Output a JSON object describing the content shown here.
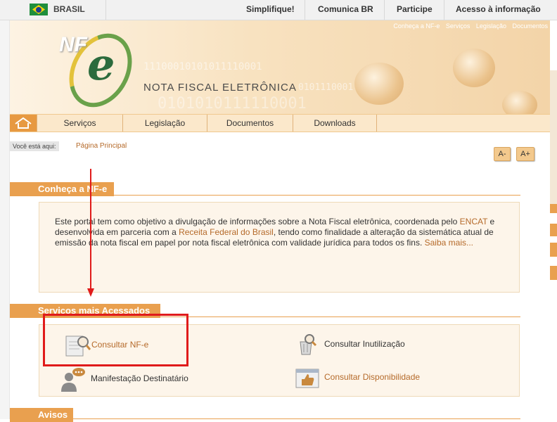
{
  "gov_bar": {
    "brand": "BRASIL",
    "links": [
      "Simplifique!",
      "Comunica BR",
      "Participe",
      "Acesso à informação"
    ]
  },
  "banner": {
    "top_links": [
      "Conheça a NF-e",
      "Serviços",
      "Legislação",
      "Documentos"
    ],
    "logo_text": "NF",
    "logo_letter": "e",
    "title": "NOTA FISCAL ELETRÔNICA",
    "binary_1": "11100010101011110001",
    "binary_2": "0101110001",
    "binary_3": "0101010111110001"
  },
  "nav": {
    "home_icon": "home-icon",
    "items": [
      "Serviços",
      "Legislação",
      "Documentos",
      "Downloads"
    ]
  },
  "breadcrumb": {
    "label": "Você está aqui:",
    "value": "Página Principal"
  },
  "font_controls": {
    "decrease": "A-",
    "increase": "A+"
  },
  "conheca": {
    "heading": "Conheça a NF-e",
    "text_1": "Este portal tem como objetivo a divulgação de informações sobre a Nota Fiscal eletrônica, coordenada pelo ",
    "link_encat": "ENCAT",
    "text_2": " e desenvolvida em parceria com a ",
    "link_receita": "Receita Federal do Brasil",
    "text_3": ", tendo como finalidade a alteração da sistemática atual de emissão da nota fiscal em papel por nota fiscal eletrônica com validade jurídica para todos os fins. ",
    "link_more": "Saiba mais..."
  },
  "servicos": {
    "heading": "Serviços mais Acessados",
    "items": [
      {
        "label": "Consultar NF-e",
        "icon": "document-search-icon"
      },
      {
        "label": "Consultar Inutilização",
        "icon": "trash-search-icon"
      },
      {
        "label": "Manifestação Destinatário",
        "icon": "user-chat-icon"
      },
      {
        "label": "Consultar Disponibilidade",
        "icon": "thumbs-up-icon"
      }
    ]
  },
  "avisos": {
    "heading": "Avisos"
  },
  "colors": {
    "accent": "#e9a04f",
    "link": "#b56a2a",
    "annotation": "#e01b1b"
  }
}
